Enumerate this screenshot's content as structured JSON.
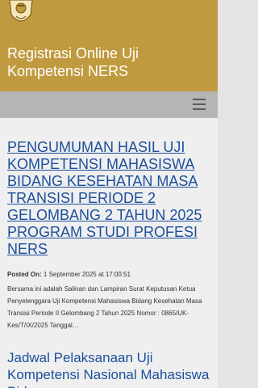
{
  "header": {
    "site_title": "Registrasi Online Uji Kompetensi NERS",
    "logo_icon": "university-emblem-icon",
    "background_color": "#c09a3e"
  },
  "navbar": {
    "menu_icon": "hamburger-menu-icon"
  },
  "posts": [
    {
      "title": "PENGUMUMAN HASIL UJI KOMPETENSI MAHASISWA BIDANG KESEHATAN MASA TRANSISI PERIODE 2 GELOMBANG 2 TAHUN 2025 PROGRAM STUDI PROFESI NERS",
      "posted_label": "Posted On:",
      "posted_date": "1 September 2025 at 17:00:51",
      "excerpt": "Bersama ini adalah Salinan dan Lampiran Surat Keputusan Ketua Penyelenggara Uji Kompetensi Mahasiswa Bidang Kesehatan Masa Transisi Periode II Gelombang 2 Tahun 2025 Nomor : 0865/UK-Kes/T/IX/2025 Tanggal…"
    },
    {
      "title": "Jadwal Pelaksanaan Uji Kompetensi Nasional Mahasiswa Bidang"
    }
  ],
  "colors": {
    "link": "#1c4f9c",
    "navbar": "#b5b5b5"
  }
}
